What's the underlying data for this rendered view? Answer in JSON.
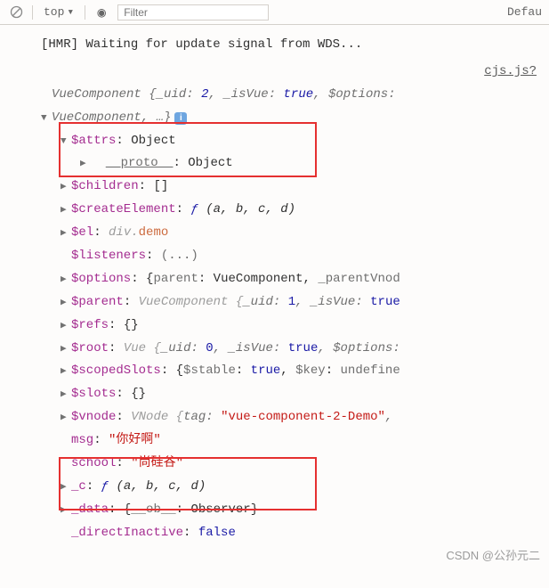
{
  "toolbar": {
    "top_label": "top",
    "eye_icon": "◉",
    "filter_placeholder": "Filter",
    "default_label": "Defau"
  },
  "log": {
    "hmr": "[HMR] Waiting for update signal from WDS..."
  },
  "link": "cjs.js?",
  "header1": {
    "cls": "VueComponent",
    "uid_k": "_uid",
    "uid_v": "2",
    "isvue_k": "_isVue",
    "isvue_v": "true",
    "opts_k": "$options"
  },
  "header2": {
    "cls": "VueComponent",
    "ellipsis": ", …}"
  },
  "attrs": {
    "key": "$attrs",
    "val": "Object"
  },
  "proto": {
    "key": "__proto__",
    "val": "Object"
  },
  "children": {
    "key": "$children",
    "val": "[]"
  },
  "createEl": {
    "key": "$createElement",
    "f": "ƒ",
    "args": "(a, b, c, d)"
  },
  "el": {
    "key": "$el",
    "tag": "div",
    "cls": "demo"
  },
  "listeners": {
    "key": "$listeners",
    "val": "(...)"
  },
  "options": {
    "key": "$options",
    "parent_k": "parent",
    "parent_v": "VueComponent",
    "pv_k": "_parentVnod"
  },
  "parent": {
    "key": "$parent",
    "cls": "VueComponent",
    "uid_k": "_uid",
    "uid_v": "1",
    "isvue_k": "_isVue",
    "isvue_v": "true"
  },
  "refs": {
    "key": "$refs",
    "val": "{}"
  },
  "root": {
    "key": "$root",
    "cls": "Vue",
    "uid_k": "_uid",
    "uid_v": "0",
    "isvue_k": "_isVue",
    "isvue_v": "true",
    "opts_k": "$options"
  },
  "scoped": {
    "key": "$scopedSlots",
    "stable_k": "$stable",
    "stable_v": "true",
    "key_k": "$key",
    "key_v": "undefine"
  },
  "slots": {
    "key": "$slots",
    "val": "{}"
  },
  "vnode": {
    "key": "$vnode",
    "cls": "VNode",
    "tag_k": "tag",
    "tag_v": "\"vue-component-2-Demo\""
  },
  "msg": {
    "key": "msg",
    "val": "\"你好啊\""
  },
  "school": {
    "key": "school",
    "val": "\"尚硅谷\""
  },
  "c": {
    "key": "_c",
    "f": "ƒ",
    "args": "(a, b, c, d)"
  },
  "data": {
    "key": "_data",
    "ob_k": "__ob__",
    "ob_v": "Observer"
  },
  "direct": {
    "key": "_directInactive",
    "val": "false"
  },
  "watermark": "CSDN @公孙元二"
}
